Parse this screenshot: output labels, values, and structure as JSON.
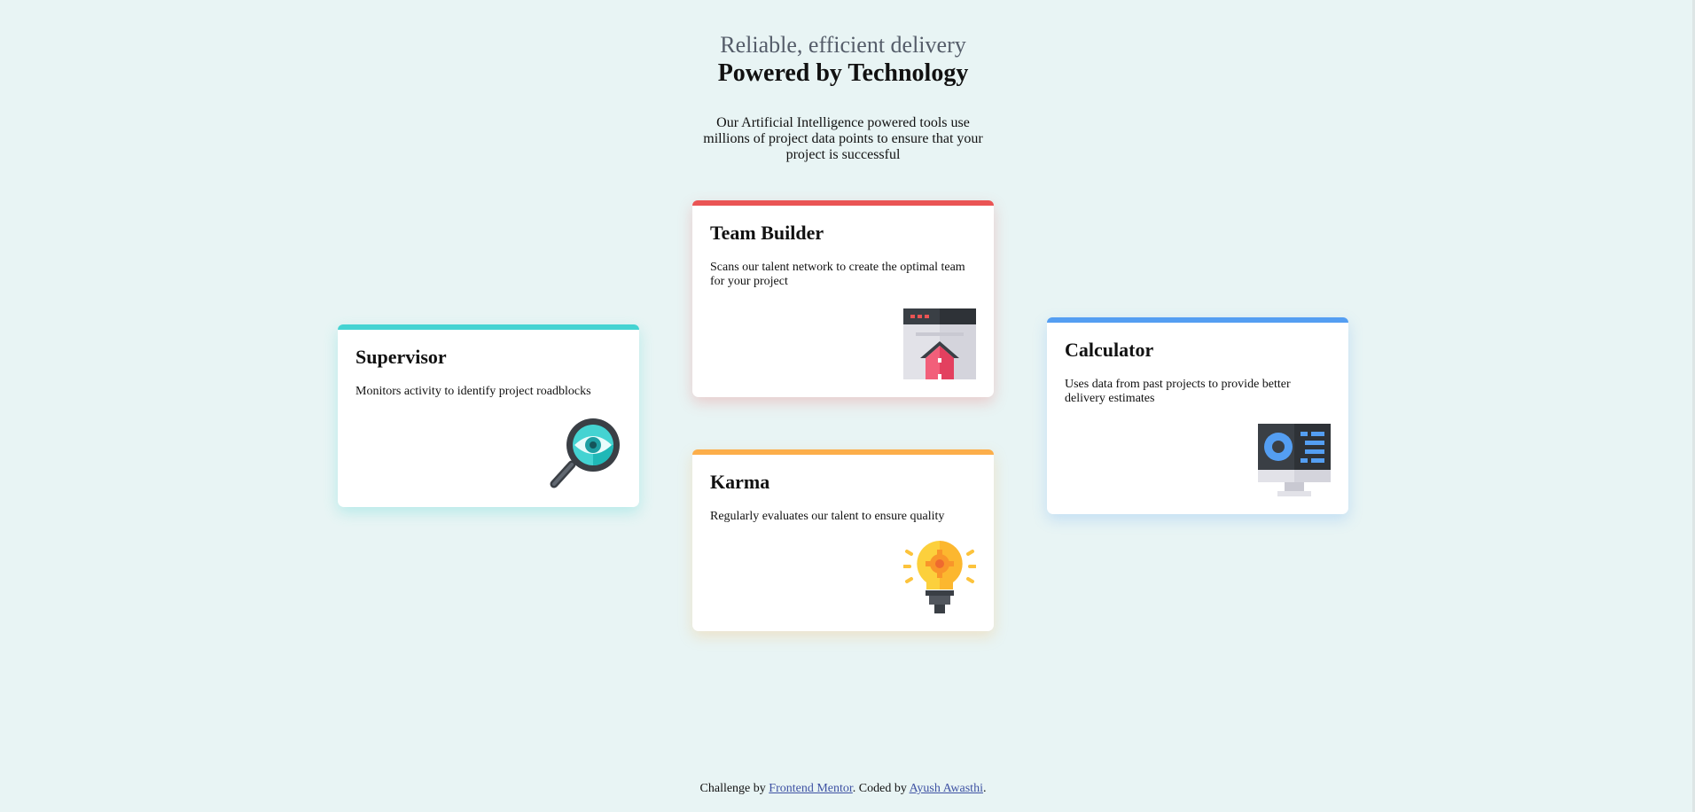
{
  "header": {
    "subtitle": "Reliable, efficient delivery",
    "title": "Powered by Technology",
    "intro": "Our Artificial Intelligence powered tools use millions of project data points to ensure that your project is successful"
  },
  "cards": {
    "supervisor": {
      "title": "Supervisor",
      "text": "Monitors activity to identify project roadblocks",
      "accent": "#44d3d2",
      "icon": "magnifier-eye-icon"
    },
    "team_builder": {
      "title": "Team Builder",
      "text": "Scans our talent network to create the optimal team for your project",
      "accent": "#ea5454",
      "icon": "team-builder-icon"
    },
    "karma": {
      "title": "Karma",
      "text": "Regularly evaluates our talent to ensure quality",
      "accent": "#fcae4a",
      "icon": "lightbulb-icon"
    },
    "calculator": {
      "title": "Calculator",
      "text": "Uses data from past projects to provide better delivery estimates",
      "accent": "#549ef2",
      "icon": "monitor-calculator-icon"
    }
  },
  "footer": {
    "challenge_by": "Challenge by",
    "frontend_mentor": "Frontend Mentor",
    "coded_by": ". Coded by",
    "author": "Ayush Awasthi",
    "period": "."
  }
}
